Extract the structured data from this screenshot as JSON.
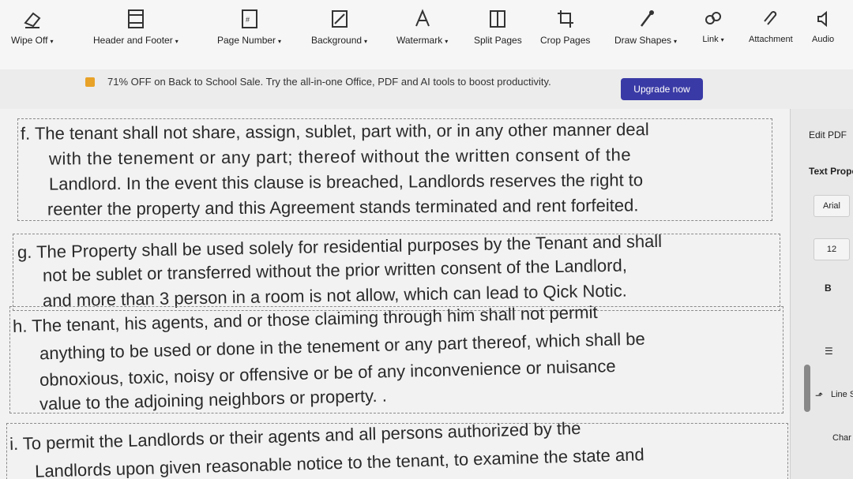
{
  "toolbar": {
    "items": [
      {
        "label": "Wipe Off",
        "dropdown": true,
        "icon": "eraser-icon"
      },
      {
        "label": "Header and Footer",
        "dropdown": true,
        "icon": "header-footer-icon"
      },
      {
        "label": "Page Number",
        "dropdown": true,
        "icon": "page-number-icon"
      },
      {
        "label": "Background",
        "dropdown": true,
        "icon": "background-icon"
      },
      {
        "label": "Watermark",
        "dropdown": true,
        "icon": "watermark-icon"
      },
      {
        "label": "Split Pages",
        "dropdown": false,
        "icon": "split-pages-icon"
      },
      {
        "label": "Crop Pages",
        "dropdown": false,
        "icon": "crop-pages-icon"
      },
      {
        "label": "Draw Shapes",
        "dropdown": true,
        "icon": "draw-shapes-icon"
      },
      {
        "label": "Link",
        "dropdown": true,
        "icon": "link-icon"
      },
      {
        "label": "Attachment",
        "dropdown": false,
        "icon": "attachment-icon"
      },
      {
        "label": "Audio",
        "dropdown": false,
        "icon": "audio-icon"
      }
    ]
  },
  "promo": {
    "text": "71% OFF on Back to School Sale. Try the all-in-one Office, PDF and AI tools to boost productivity.",
    "button": "Upgrade now"
  },
  "document": {
    "para_f": [
      "f.  The tenant shall not share, assign, sublet, part with, or in any other manner deal",
      "with the tenement or any part; thereof without the written consent of the",
      "Landlord. In the event this clause is breached, Landlords reserves the right to",
      "reenter the property and this Agreement stands terminated and rent forfeited."
    ],
    "para_g": [
      "g.  The Property shall be used solely for residential purposes by the Tenant and shall",
      "not be sublet or transferred without the prior written consent of the Landlord,",
      "and more than 3 person in a room is not allow, which can lead to Qick Notic."
    ],
    "para_h": [
      "h.  The tenant, his agents, and or those claiming through him shall not permit",
      "anything to be used or done in the tenement or any part thereof, which shall be",
      "obnoxious, toxic, noisy or offensive or be of any inconvenience or nuisance",
      "value to the adjoining neighbors or property. ."
    ],
    "para_i": [
      "i.  To permit the Landlords or their agents and all persons authorized by the",
      "Landlords upon given reasonable notice to the tenant, to examine the state and"
    ]
  },
  "right_panel": {
    "edit_pdf": "Edit PDF",
    "text_props": "Text Prope",
    "font": "Arial",
    "size": "12",
    "bold": "B",
    "line": "Line S",
    "char": "Char"
  }
}
